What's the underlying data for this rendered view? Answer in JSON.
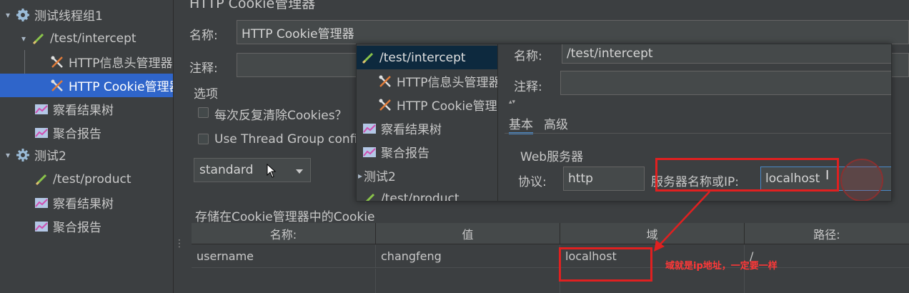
{
  "tree": {
    "nodes": [
      {
        "label": "测试线程组1",
        "toggle": "▾",
        "icon": "gear-icon"
      },
      {
        "label": "/test/intercept",
        "toggle": "▾",
        "icon": "pen-icon"
      },
      {
        "label": "HTTP信息头管理器",
        "icon": "tools-icon"
      },
      {
        "label": "HTTP Cookie管理器",
        "icon": "tools-icon"
      },
      {
        "label": "察看结果树",
        "icon": "chart-icon"
      },
      {
        "label": "聚合报告",
        "icon": "chart-icon"
      },
      {
        "label": "测试2",
        "toggle": "▾",
        "icon": "gear-icon"
      },
      {
        "label": "/test/product",
        "icon": "pen-icon"
      },
      {
        "label": "察看结果树",
        "icon": "chart-icon"
      },
      {
        "label": "聚合报告",
        "icon": "chart-icon"
      }
    ]
  },
  "main": {
    "title": "HTTP Cookie管理器",
    "name_label": "名称:",
    "name_value": "HTTP Cookie管理器",
    "comment_label": "注释:",
    "options_label": "选项",
    "clear_each_iteration": "每次反复清除Cookies？",
    "use_thread_group": "Use Thread Group config",
    "policy_value": "standard",
    "stored_cookies_label": "存储在Cookie管理器中的Cookie",
    "table": {
      "headers": [
        "名称:",
        "值",
        "域",
        "路径:"
      ],
      "rows": [
        [
          "username",
          "changfeng",
          "localhost",
          "/"
        ]
      ]
    }
  },
  "overlay": {
    "tree": [
      {
        "label": "/test/intercept",
        "icon": "pen-icon"
      },
      {
        "label": "HTTP信息头管理器",
        "icon": "tools-icon"
      },
      {
        "label": "HTTP Cookie管理器",
        "icon": "tools-icon"
      },
      {
        "label": "察看结果树",
        "icon": "chart-icon"
      },
      {
        "label": "聚合报告",
        "icon": "chart-icon"
      },
      {
        "label": "测试2",
        "toggle": "▸"
      },
      {
        "label": "/test/product",
        "icon": "pen-icon"
      }
    ],
    "name_label": "名称:",
    "name_value": "/test/intercept",
    "comment_label": "注释:",
    "tabs": [
      "基本",
      "高级"
    ],
    "web_server_label": "Web服务器",
    "protocol_label": "协议:",
    "protocol_value": "http",
    "server_label": "服务器名称或IP:",
    "server_value": "localhost"
  },
  "annotation": {
    "note": "域就是ip地址，一定要一样",
    "color": "#e02020"
  }
}
